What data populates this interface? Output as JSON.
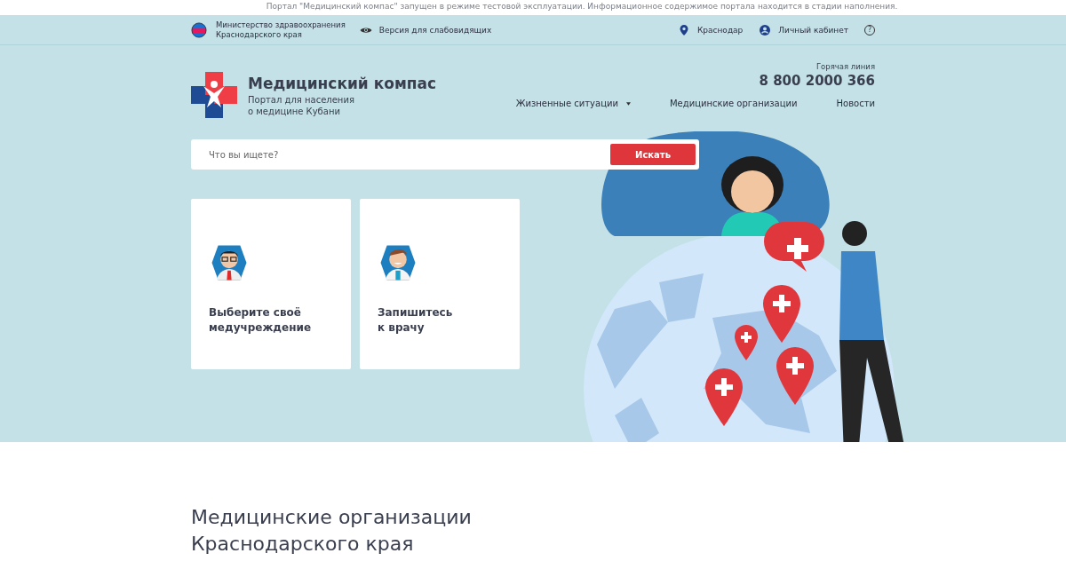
{
  "notice": "Портал \"Медицинский компас\" запущен в режиме тестовой эксплуатации. Информационное содержимое портала находится в стадии наполнения.",
  "topbar": {
    "ministry": [
      "Министерство здравоохранения",
      "Краснодарского края"
    ],
    "accessibility": "Версия для слабовидящих",
    "city": "Краснодар",
    "account": "Личный кабинет",
    "help": "?"
  },
  "logo": {
    "title": "Медицинский компас",
    "subtitle": [
      "Портал для населения",
      "о медицине Кубани"
    ]
  },
  "hotline": {
    "label": "Горячая линия",
    "phone": "8 800 2000 366"
  },
  "nav": [
    {
      "label": "Жизненные ситуации",
      "dropdown": true
    },
    {
      "label": "Медицинские организации",
      "dropdown": false
    },
    {
      "label": "Новости",
      "dropdown": false
    }
  ],
  "search": {
    "placeholder": "Что вы ищете?",
    "button": "Искать"
  },
  "cards": [
    {
      "kind": "glasses",
      "title": [
        "Выберите своё",
        "медучреждение"
      ]
    },
    {
      "kind": "smile",
      "title": [
        "Запишитесь",
        "к врачу"
      ]
    }
  ],
  "section_title": [
    "Медицинские организации",
    "Краснодарского края"
  ]
}
